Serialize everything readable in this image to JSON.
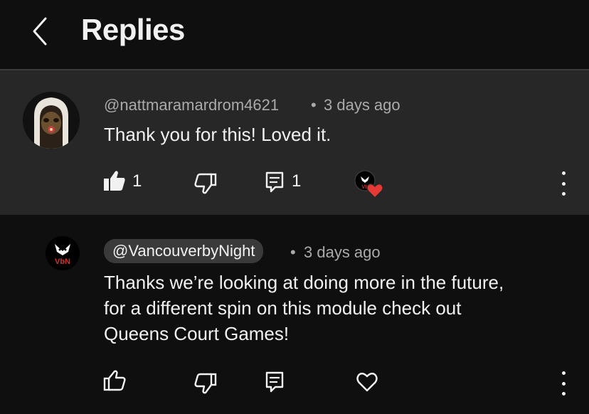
{
  "header": {
    "title": "Replies"
  },
  "comment": {
    "handle": "@nattmaramardrom4621",
    "separator": "•",
    "time": "3 days ago",
    "text": "Thank you for this! Loved it.",
    "like_count": "1",
    "reply_count": "1",
    "creator_heart_badge": "Vb"
  },
  "reply": {
    "handle": "@VancouverbyNight",
    "separator": "•",
    "time": "3 days ago",
    "text_lines": [
      "Thanks we’re looking at doing more in the future,",
      "for a different spin on this module check out",
      "Queens Court Games!"
    ],
    "avatar_text": "VbN"
  },
  "colors": {
    "heart": "#e53935",
    "avatar_text": "#d32f2f",
    "pill": "#3a3a3a"
  }
}
